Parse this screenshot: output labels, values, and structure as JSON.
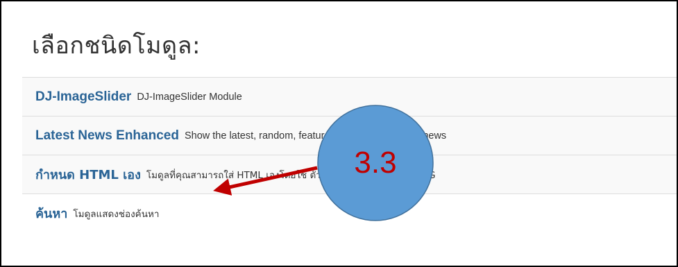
{
  "page": {
    "title": "เลือกชนิดโมดูล:"
  },
  "modules": [
    {
      "name": "DJ-ImageSlider",
      "description": "DJ-ImageSlider Module"
    },
    {
      "name": "Latest News Enhanced",
      "description": "Show the latest, random, featured, popular or related news"
    },
    {
      "name": "กำหนด HTML เอง",
      "description": "โมดูลที่คุณสามารถใส่ HTML เองโดยใช้ ตัวช่วยเขียนเนื้อหา WYSIWYG"
    },
    {
      "name": "ค้นหา",
      "description": "โมดูลแสดงช่องค้นหา"
    }
  ],
  "annotation": {
    "label": "3.3",
    "circle_color": "#5b9bd5",
    "arrow_color": "#c00000",
    "label_color": "#c00000"
  }
}
